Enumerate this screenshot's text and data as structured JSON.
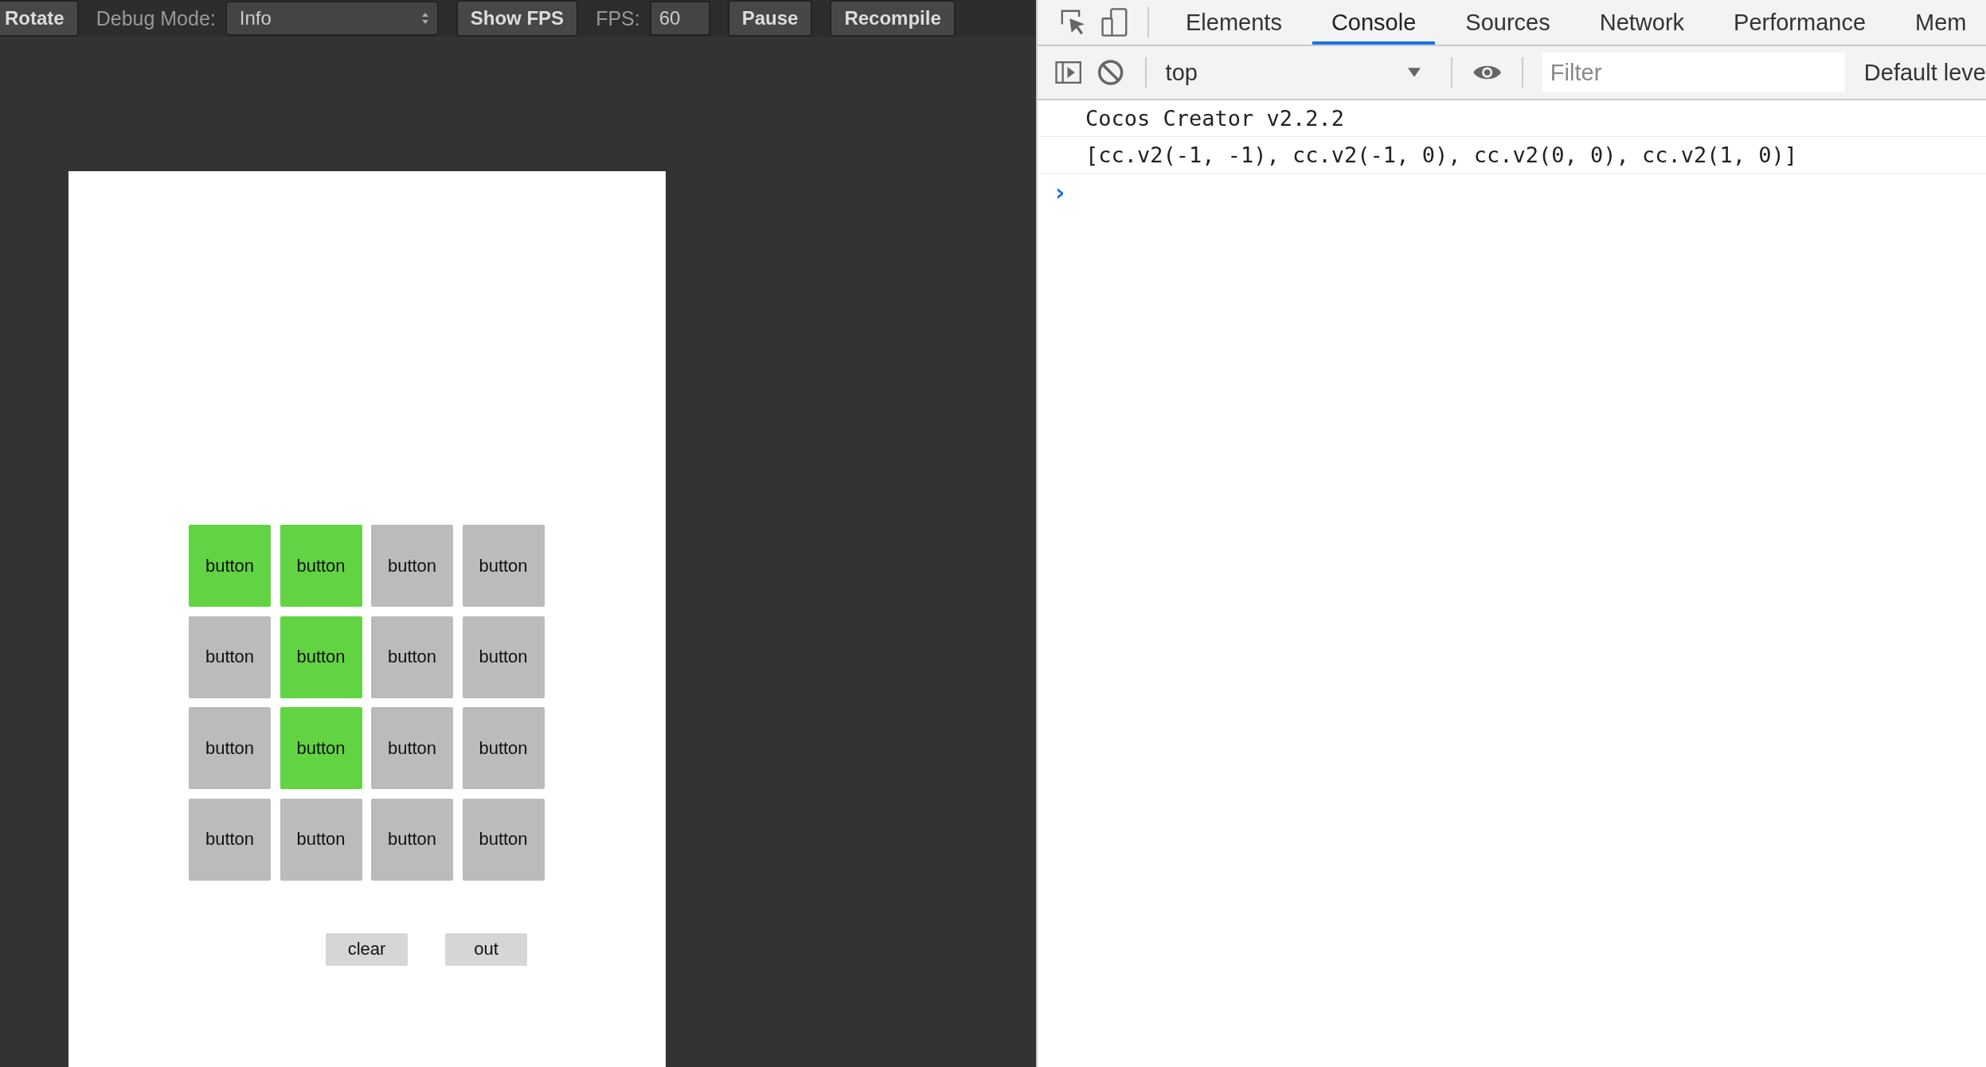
{
  "simulator_toolbar": {
    "rotate_button": "Rotate",
    "debug_mode_label": "Debug Mode:",
    "debug_mode_select": "Info",
    "show_fps_button": "Show FPS",
    "fps_label": "FPS:",
    "fps_field": "60",
    "pause_button": "Pause",
    "recompile_button": "Recompile"
  },
  "game": {
    "grid": [
      [
        {
          "label": "button",
          "on": true
        },
        {
          "label": "button",
          "on": true
        },
        {
          "label": "button",
          "on": false
        },
        {
          "label": "button",
          "on": false
        }
      ],
      [
        {
          "label": "button",
          "on": false
        },
        {
          "label": "button",
          "on": true
        },
        {
          "label": "button",
          "on": false
        },
        {
          "label": "button",
          "on": false
        }
      ],
      [
        {
          "label": "button",
          "on": false
        },
        {
          "label": "button",
          "on": true
        },
        {
          "label": "button",
          "on": false
        },
        {
          "label": "button",
          "on": false
        }
      ],
      [
        {
          "label": "button",
          "on": false
        },
        {
          "label": "button",
          "on": false
        },
        {
          "label": "button",
          "on": false
        },
        {
          "label": "button",
          "on": false
        }
      ]
    ],
    "actions": [
      "clear",
      "out"
    ]
  },
  "devtools": {
    "tabs": [
      {
        "label": "Elements",
        "selected": false
      },
      {
        "label": "Console",
        "selected": true
      },
      {
        "label": "Sources",
        "selected": false
      },
      {
        "label": "Network",
        "selected": false
      },
      {
        "label": "Performance",
        "selected": false
      },
      {
        "label": "Mem",
        "selected": false
      }
    ],
    "context_select": "top",
    "filter": {
      "placeholder": "Filter"
    },
    "levels_select": "Default leve",
    "console_lines": [
      "Cocos Creator v2.2.2",
      "[cc.v2(-1, -1), cc.v2(-1, 0), cc.v2(0, 0), cc.v2(1, 0)]"
    ],
    "prompt": "›"
  }
}
